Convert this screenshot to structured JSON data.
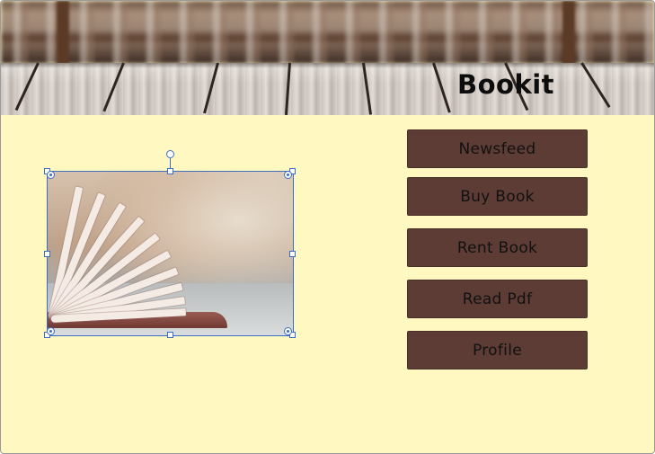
{
  "app": {
    "title": "Bookit"
  },
  "nav": {
    "items": [
      {
        "label": "Newsfeed"
      },
      {
        "label": "Buy Book"
      },
      {
        "label": "Rent Book"
      },
      {
        "label": "Read Pdf"
      },
      {
        "label": "Profile"
      }
    ]
  },
  "colors": {
    "background": "#fff8c0",
    "button_fill": "#5d3c35",
    "selection": "#3d6cc4"
  },
  "image": {
    "subject": "open-book-photo",
    "selected": true
  }
}
